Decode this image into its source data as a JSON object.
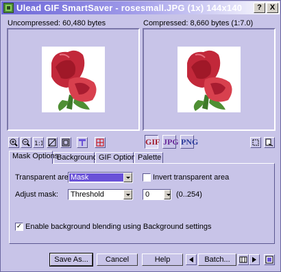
{
  "window": {
    "title": "Ulead GIF SmartSaver - rosesmall.JPG (1x) 144x140",
    "help_button": "?",
    "close_button": "X"
  },
  "previews": {
    "uncompressed_label": "Uncompressed: 60,480 bytes",
    "compressed_label": "Compressed: 8,660 bytes (1:7.0)"
  },
  "format_buttons": [
    "GIF",
    "JPG",
    "PNG"
  ],
  "tabs": [
    "Mask Options",
    "Background",
    "GIF Options",
    "Palette"
  ],
  "mask_options": {
    "transparent_area_label": "Transparent area:",
    "transparent_area_value": "Mask",
    "invert_label": "Invert transparent area",
    "invert_checked": false,
    "adjust_mask_label": "Adjust mask:",
    "adjust_mask_value": "Threshold",
    "threshold_value": "0",
    "range_label": "(0..254)",
    "blending_label": "Enable background blending using Background settings",
    "blending_checked": true
  },
  "buttons": {
    "save_as": "Save As...",
    "cancel": "Cancel",
    "help": "Help",
    "batch": "Batch..."
  },
  "colors": {
    "dialog_bg": "#c8c4e8",
    "title_gradient_start": "#6c66d8",
    "selection": "#6a52d8"
  }
}
